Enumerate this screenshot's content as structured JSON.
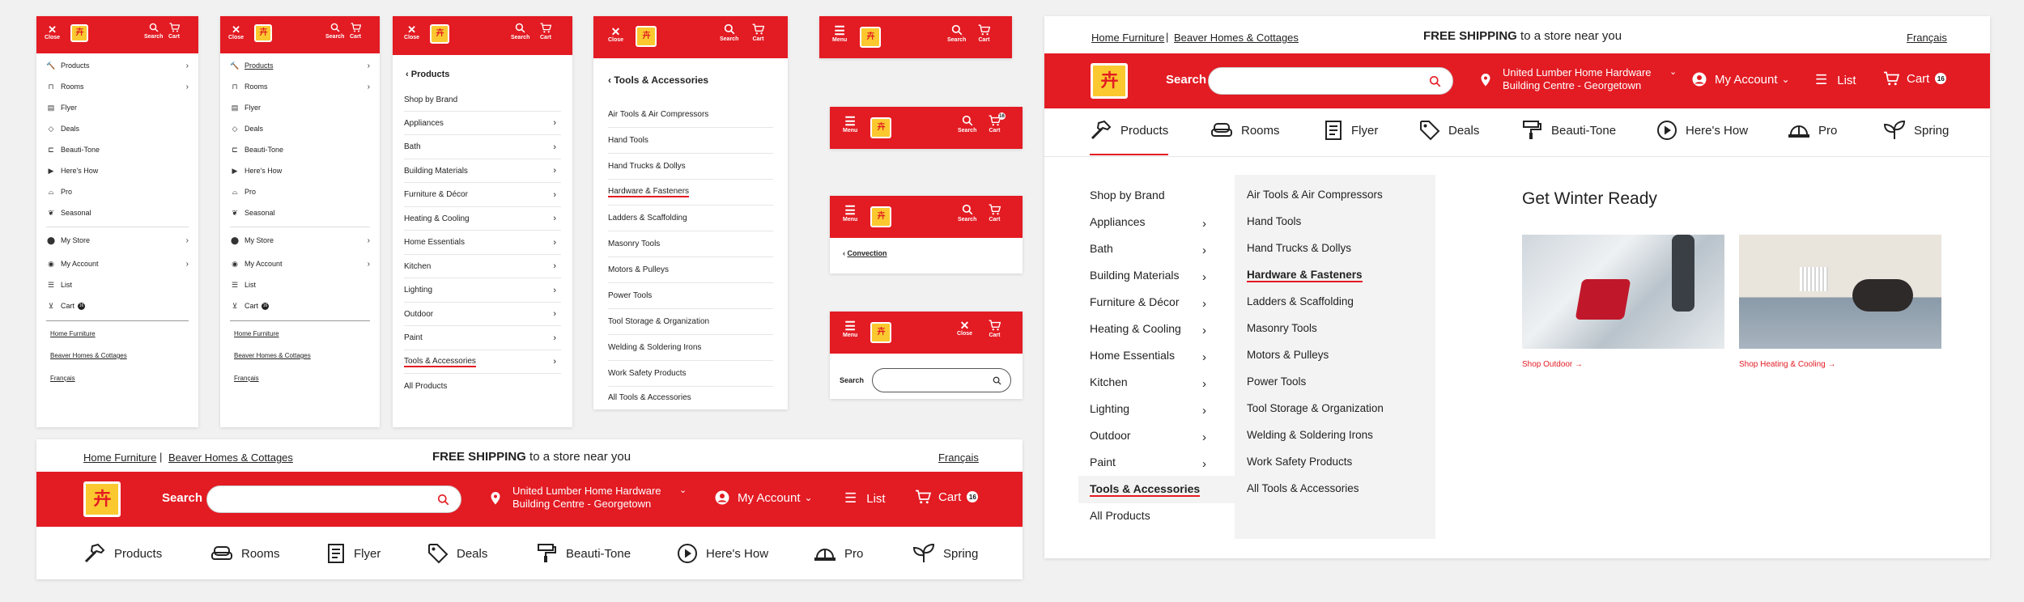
{
  "brand_color": "#e31b23",
  "logo_accent": "#fbc82f",
  "labels": {
    "close": "Close",
    "search": "Search",
    "cart": "Cart",
    "menu": "Menu",
    "cart_count": "16"
  },
  "main_menu": [
    {
      "label": "Products",
      "icon": "hammer-icon",
      "chevron": true
    },
    {
      "label": "Rooms",
      "icon": "sofa-icon",
      "chevron": true
    },
    {
      "label": "Flyer",
      "icon": "flyer-icon"
    },
    {
      "label": "Deals",
      "icon": "tag-icon"
    },
    {
      "label": "Beauti-Tone",
      "icon": "paint-roller-icon"
    },
    {
      "label": "Here's How",
      "icon": "play-icon"
    },
    {
      "label": "Pro",
      "icon": "hardhat-icon"
    },
    {
      "label": "Seasonal",
      "icon": "leaf-icon"
    }
  ],
  "account_menu": [
    {
      "label": "My Store",
      "icon": "pin-icon",
      "chevron": true
    },
    {
      "label": "My Account",
      "icon": "user-icon",
      "chevron": true
    },
    {
      "label": "List",
      "icon": "list-icon"
    },
    {
      "label": "Cart",
      "icon": "cart-icon"
    }
  ],
  "footer_links": [
    "Home Furniture",
    "Beaver Homes & Cottages",
    "Français"
  ],
  "products_panel": {
    "back_label": "Products",
    "items": [
      {
        "label": "Shop by Brand",
        "chevron": false
      },
      {
        "label": "Appliances",
        "chevron": true
      },
      {
        "label": "Bath",
        "chevron": true
      },
      {
        "label": "Building Materials",
        "chevron": true
      },
      {
        "label": "Furniture & Décor",
        "chevron": true
      },
      {
        "label": "Heating & Cooling",
        "chevron": true
      },
      {
        "label": "Home Essentials",
        "chevron": true
      },
      {
        "label": "Kitchen",
        "chevron": true
      },
      {
        "label": "Lighting",
        "chevron": true
      },
      {
        "label": "Outdoor",
        "chevron": true
      },
      {
        "label": "Paint",
        "chevron": true
      },
      {
        "label": "Tools & Accessories",
        "chevron": true
      },
      {
        "label": "All Products",
        "chevron": false
      }
    ]
  },
  "tools_panel": {
    "back_label": "Tools & Accessories",
    "items": [
      "Air Tools & Air Compressors",
      "Hand Tools",
      "Hand Trucks & Dollys",
      "Hardware & Fasteners",
      "Ladders & Scaffolding",
      "Masonry Tools",
      "Motors & Pulleys",
      "Power Tools",
      "Tool Storage & Organization",
      "Welding & Soldering Irons",
      "Work Safety Products",
      "All Tools & Accessories"
    ]
  },
  "breadcrumb_link": "Convection",
  "search_label": "Search",
  "header": {
    "top_links": [
      "Home Furniture",
      "Beaver Homes & Cottages"
    ],
    "shipping_bold": "FREE SHIPPING",
    "shipping_rest": "to a store near you",
    "language": "Français",
    "search_label": "Search",
    "store_line1": "United Lumber Home Hardware",
    "store_line2": "Building Centre - Georgetown",
    "account": "My Account",
    "list": "List",
    "cart": "Cart",
    "cart_count": "16"
  },
  "nav": [
    {
      "label": "Products",
      "icon": "hammer-icon"
    },
    {
      "label": "Rooms",
      "icon": "sofa-icon"
    },
    {
      "label": "Flyer",
      "icon": "flyer-icon"
    },
    {
      "label": "Deals",
      "icon": "tag-icon"
    },
    {
      "label": "Beauti-Tone",
      "icon": "paint-roller-icon"
    },
    {
      "label": "Here's How",
      "icon": "play-icon"
    },
    {
      "label": "Pro",
      "icon": "hardhat-icon"
    },
    {
      "label": "Spring",
      "icon": "leaf-icon"
    }
  ],
  "mega": {
    "categories": [
      "Shop by Brand",
      "Appliances",
      "Bath",
      "Building Materials",
      "Furniture & Décor",
      "Heating & Cooling",
      "Home Essentials",
      "Kitchen",
      "Lighting",
      "Outdoor",
      "Paint",
      "Tools & Accessories",
      "All Products"
    ],
    "subcategories": [
      "Air Tools & Air Compressors",
      "Hand Tools",
      "Hand Trucks & Dollys",
      "Hardware & Fasteners",
      "Ladders & Scaffolding",
      "Masonry Tools",
      "Motors & Pulleys",
      "Power Tools",
      "Tool Storage & Organization",
      "Welding & Soldering Irons",
      "Work Safety Products",
      "All Tools & Accessories"
    ],
    "promo_title": "Get Winter Ready",
    "promo1": "Shop Outdoor",
    "promo2": "Shop Heating & Cooling"
  }
}
